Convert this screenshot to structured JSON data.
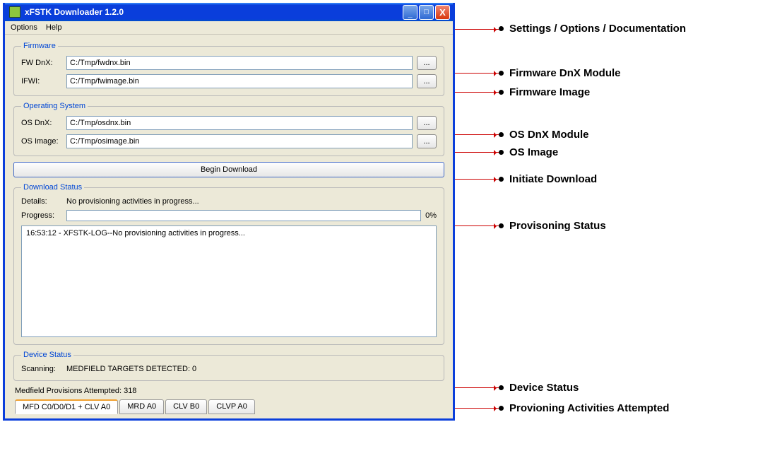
{
  "window": {
    "title": "xFSTK Downloader 1.2.0",
    "min_icon": "—",
    "max_icon": "▭",
    "close_icon": "X"
  },
  "menu": {
    "options": "Options",
    "help": "Help"
  },
  "firmware": {
    "legend": "Firmware",
    "fw_dnx_label": "FW DnX:",
    "fw_dnx_value": "C:/Tmp/fwdnx.bin",
    "ifwi_label": "IFWI:",
    "ifwi_value": "C:/Tmp/fwimage.bin",
    "browse": "..."
  },
  "os": {
    "legend": "Operating System",
    "os_dnx_label": "OS DnX:",
    "os_dnx_value": "C:/Tmp/osdnx.bin",
    "os_image_label": "OS Image:",
    "os_image_value": "C:/Tmp/osimage.bin",
    "browse": "..."
  },
  "download": {
    "begin_label": "Begin Download"
  },
  "status": {
    "legend": "Download Status",
    "details_label": "Details:",
    "details_value": "No provisioning activities in progress...",
    "progress_label": "Progress:",
    "progress_pct": "0%",
    "log_line": "16:53:12 - XFSTK-LOG--No provisioning activities in progress..."
  },
  "device": {
    "legend": "Device Status",
    "scanning_label": "Scanning:",
    "scanning_value": "MEDFIELD TARGETS DETECTED: 0"
  },
  "attempts": "Medfield Provisions Attempted: 318",
  "tabs": {
    "t1": "MFD C0/D0/D1 + CLV A0",
    "t2": "MRD A0",
    "t3": "CLV B0",
    "t4": "CLVP A0"
  },
  "annotations": {
    "a1": "Settings / Options / Documentation",
    "a2": "Firmware DnX Module",
    "a3": "Firmware Image",
    "a4": "OS DnX Module",
    "a5": "OS Image",
    "a6": "Initiate Download",
    "a7": "Provisoning Status",
    "a8": "Device Status",
    "a9": "Provioning Activities Attempted"
  }
}
